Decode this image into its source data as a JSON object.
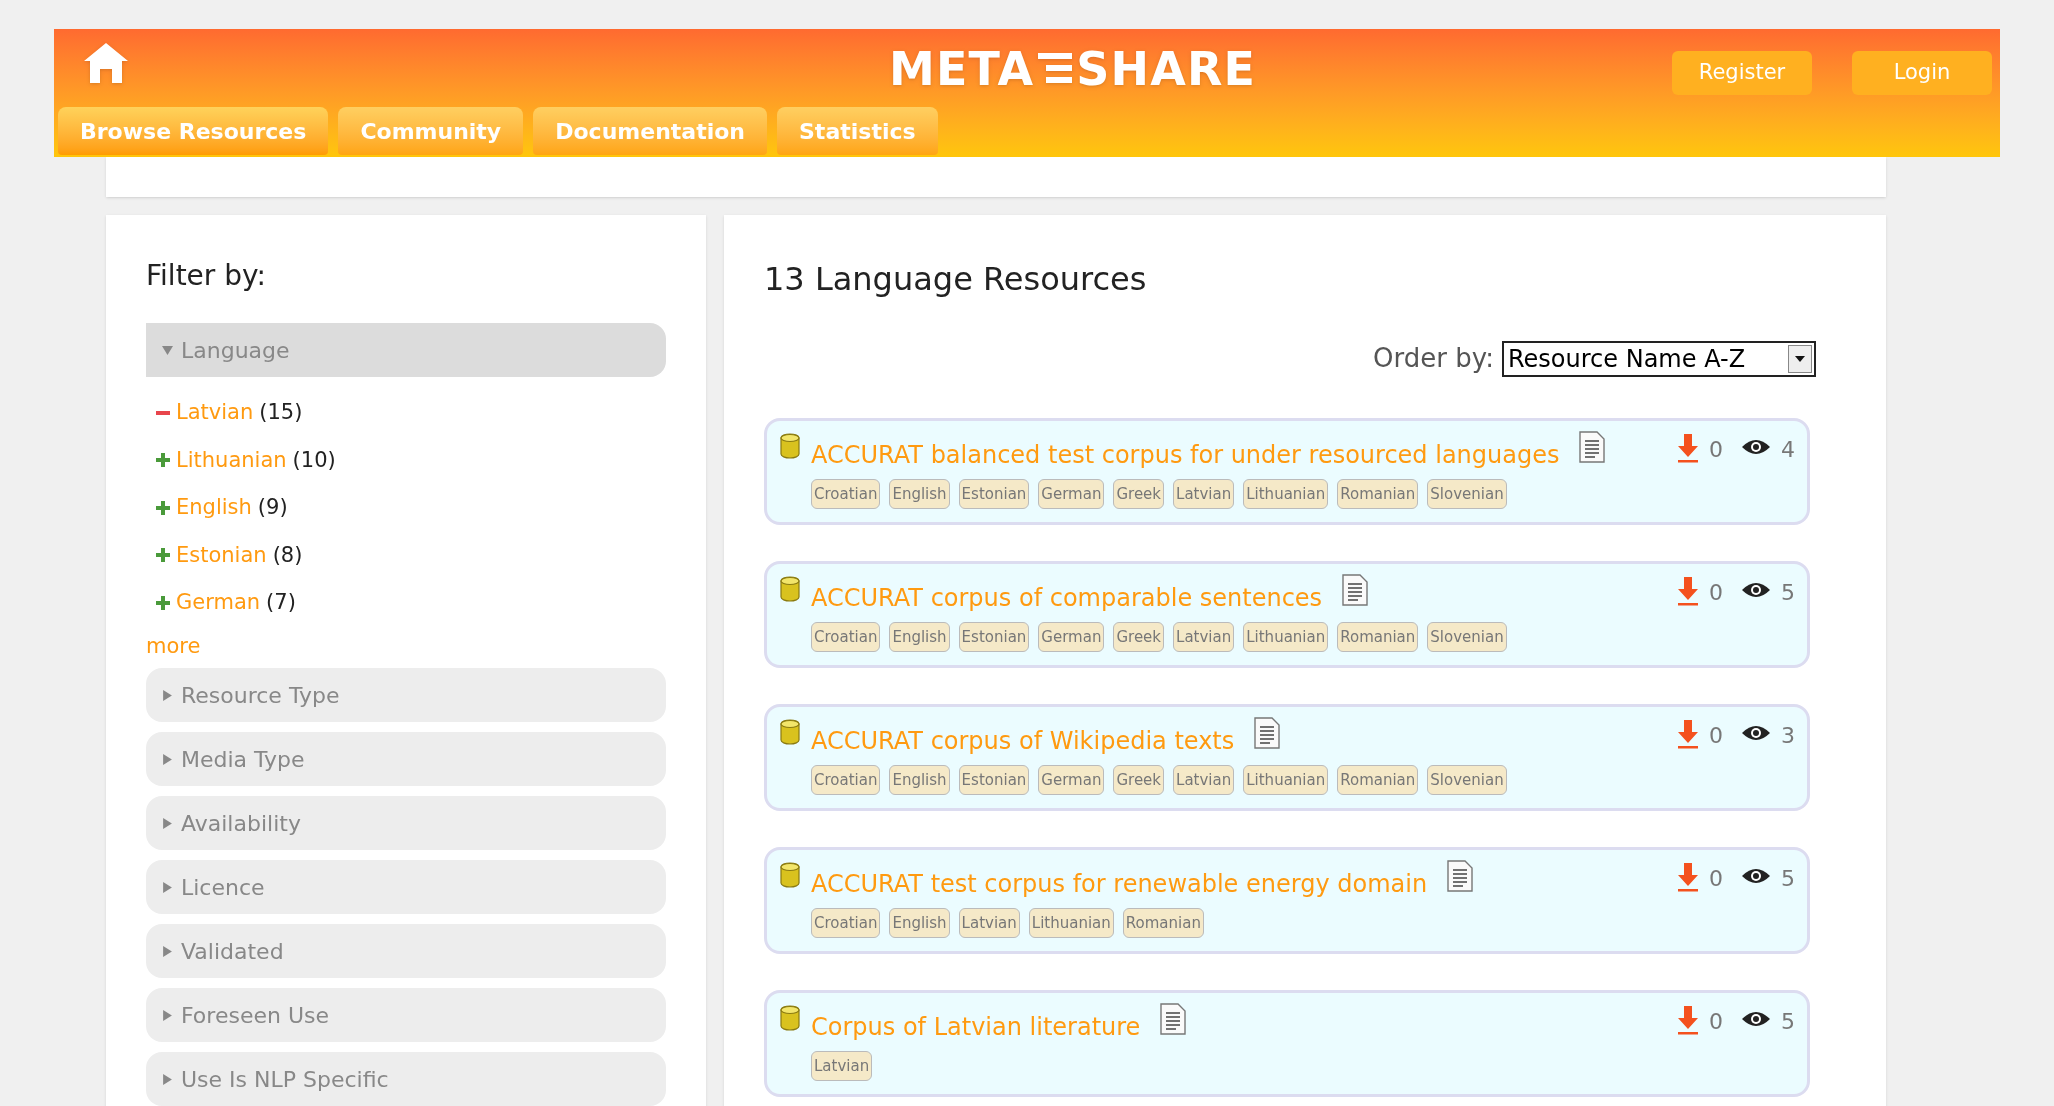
{
  "header": {
    "logo_left": "META",
    "logo_right": "SHARE",
    "nav": [
      {
        "label": "Browse Resources",
        "selected": true
      },
      {
        "label": "Community",
        "selected": false
      },
      {
        "label": "Documentation",
        "selected": false
      },
      {
        "label": "Statistics",
        "selected": false
      }
    ],
    "buttons": [
      "Register",
      "Login"
    ]
  },
  "sidebar": {
    "title": "Filter by:",
    "filters": [
      {
        "label": "Language",
        "expanded": true,
        "items": [
          {
            "name": "Latvian",
            "count": "(15)",
            "selected": true
          },
          {
            "name": "Lithuanian",
            "count": "(10)",
            "selected": false
          },
          {
            "name": "English",
            "count": "(9)",
            "selected": false
          },
          {
            "name": "Estonian",
            "count": "(8)",
            "selected": false
          },
          {
            "name": "German",
            "count": "(7)",
            "selected": false
          }
        ],
        "more": "more"
      },
      {
        "label": "Resource Type",
        "expanded": false
      },
      {
        "label": "Media Type",
        "expanded": false
      },
      {
        "label": "Availability",
        "expanded": false
      },
      {
        "label": "Licence",
        "expanded": false
      },
      {
        "label": "Validated",
        "expanded": false
      },
      {
        "label": "Foreseen Use",
        "expanded": false
      },
      {
        "label": "Use Is NLP Specific",
        "expanded": false
      }
    ]
  },
  "results": {
    "title": "13 Language Resources",
    "order_label": "Order by:",
    "order_value": "Resource Name A-Z",
    "items": [
      {
        "title": "ACCURAT balanced test corpus for under resourced languages",
        "tags": [
          "Croatian",
          "English",
          "Estonian",
          "German",
          "Greek",
          "Latvian",
          "Lithuanian",
          "Romanian",
          "Slovenian"
        ],
        "downloads": "0",
        "views": "4"
      },
      {
        "title": "ACCURAT corpus of comparable sentences",
        "tags": [
          "Croatian",
          "English",
          "Estonian",
          "German",
          "Greek",
          "Latvian",
          "Lithuanian",
          "Romanian",
          "Slovenian"
        ],
        "downloads": "0",
        "views": "5"
      },
      {
        "title": "ACCURAT corpus of Wikipedia texts",
        "tags": [
          "Croatian",
          "English",
          "Estonian",
          "German",
          "Greek",
          "Latvian",
          "Lithuanian",
          "Romanian",
          "Slovenian"
        ],
        "downloads": "0",
        "views": "3"
      },
      {
        "title": "ACCURAT test corpus for renewable energy domain",
        "tags": [
          "Croatian",
          "English",
          "Latvian",
          "Lithuanian",
          "Romanian"
        ],
        "downloads": "0",
        "views": "5"
      },
      {
        "title": "Corpus of Latvian literature",
        "tags": [
          "Latvian"
        ],
        "downloads": "0",
        "views": "5"
      }
    ]
  }
}
